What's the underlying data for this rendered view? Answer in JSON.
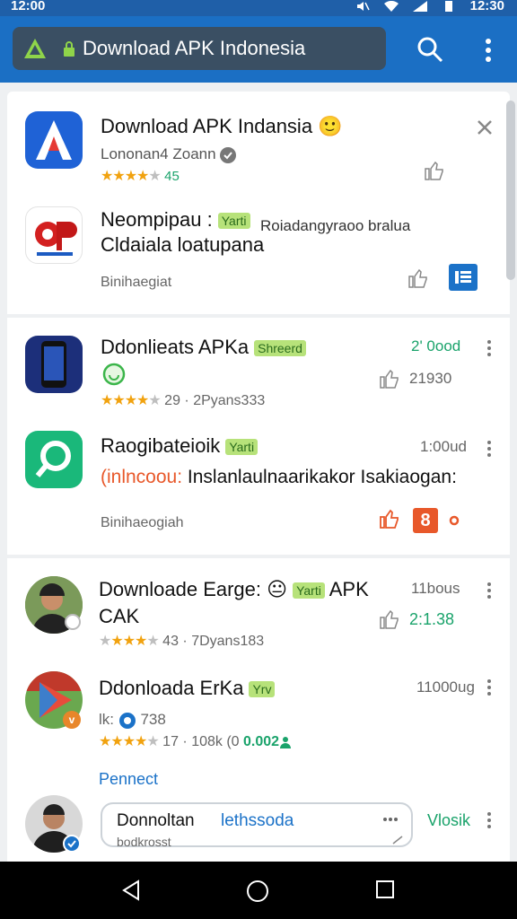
{
  "status": {
    "time_left": "12:00",
    "time_right": "12:30"
  },
  "appbar": {
    "url": "Download APK Indonesia"
  },
  "card1": {
    "item1": {
      "title": "Download APK Indansia",
      "emoji": "🙂",
      "sub": "Lononan4 Zoann",
      "rating_text": "45"
    },
    "item2": {
      "title": "Neompipau :",
      "tag": "Yarti",
      "desc": "Roiadangyraoo bralua",
      "line2": "Cldaiala loatupana"
    },
    "footer": "Binihaegiat"
  },
  "card2": {
    "item1": {
      "title": "Ddonlieats APKa",
      "tag": "Shreerd",
      "right": "2' 0ood",
      "likes": "21930",
      "meta": "29 · 2Pyans333"
    },
    "item2": {
      "title": "Raogibateioik",
      "tag": "Yarti",
      "right": "1:00ud",
      "line2a": "(inlncoou:",
      "line2b": " Inslanlaulnaarikakor Isakiaogan:"
    },
    "footer": "Binihaeogiah",
    "count": "8"
  },
  "card3": {
    "item1": {
      "title_a": "Downloade Earge:",
      "emoji": "😐",
      "tag": "Yarti",
      "title_b": " APK",
      "line2": "CAK",
      "right": "11bous",
      "likes": "2:1.38",
      "meta": "43 · 7Dyans183"
    },
    "item2": {
      "title": "Ddonloada ErKa",
      "tag": "Yrv",
      "right": "11000ug",
      "line2": "lk: ",
      "line2b": " 738",
      "meta_a": "17 · 108k (0",
      "meta_b": "0.00",
      "meta_c": "2"
    },
    "section_label": "Pennect",
    "item3": {
      "title": "Donnoltan",
      "blue": "lethssoda",
      "sub": "bodkrosst",
      "right": "Vlosik"
    }
  },
  "colors": {
    "primary": "#1b6fc4",
    "accent_green": "#1aa36b",
    "tag_green": "#b7e27a",
    "star": "#f1a20f",
    "badge_orange": "#e8582a"
  }
}
